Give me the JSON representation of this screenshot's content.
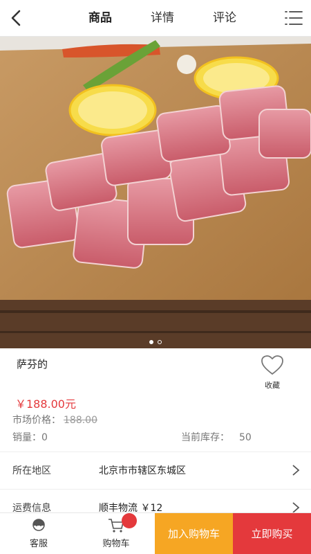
{
  "header": {
    "tabs": [
      {
        "label": "商品",
        "active": true
      },
      {
        "label": "详情",
        "active": false
      },
      {
        "label": "评论",
        "active": false
      }
    ]
  },
  "product": {
    "title": "萨芬的",
    "price": "￥188.00元",
    "market_label": "市场价格：",
    "market_price": "188.00",
    "sales_label": "销量：",
    "sales_value": "0",
    "stock_label": "当前库存：",
    "stock_value": "50",
    "favorite_label": "收藏"
  },
  "carousel": {
    "dots": 2,
    "active_index": 0
  },
  "info_rows": [
    {
      "label": "所在地区",
      "value": "北京市市辖区东城区"
    },
    {
      "label": "运费信息",
      "value": "顺丰物流 ￥12"
    }
  ],
  "bottom_bar": {
    "service_label": "客服",
    "cart_label": "购物车",
    "add_to_cart_label": "加入购物车",
    "buy_now_label": "立即购买"
  },
  "colors": {
    "accent_red": "#e4393c",
    "accent_orange": "#f6a623"
  }
}
